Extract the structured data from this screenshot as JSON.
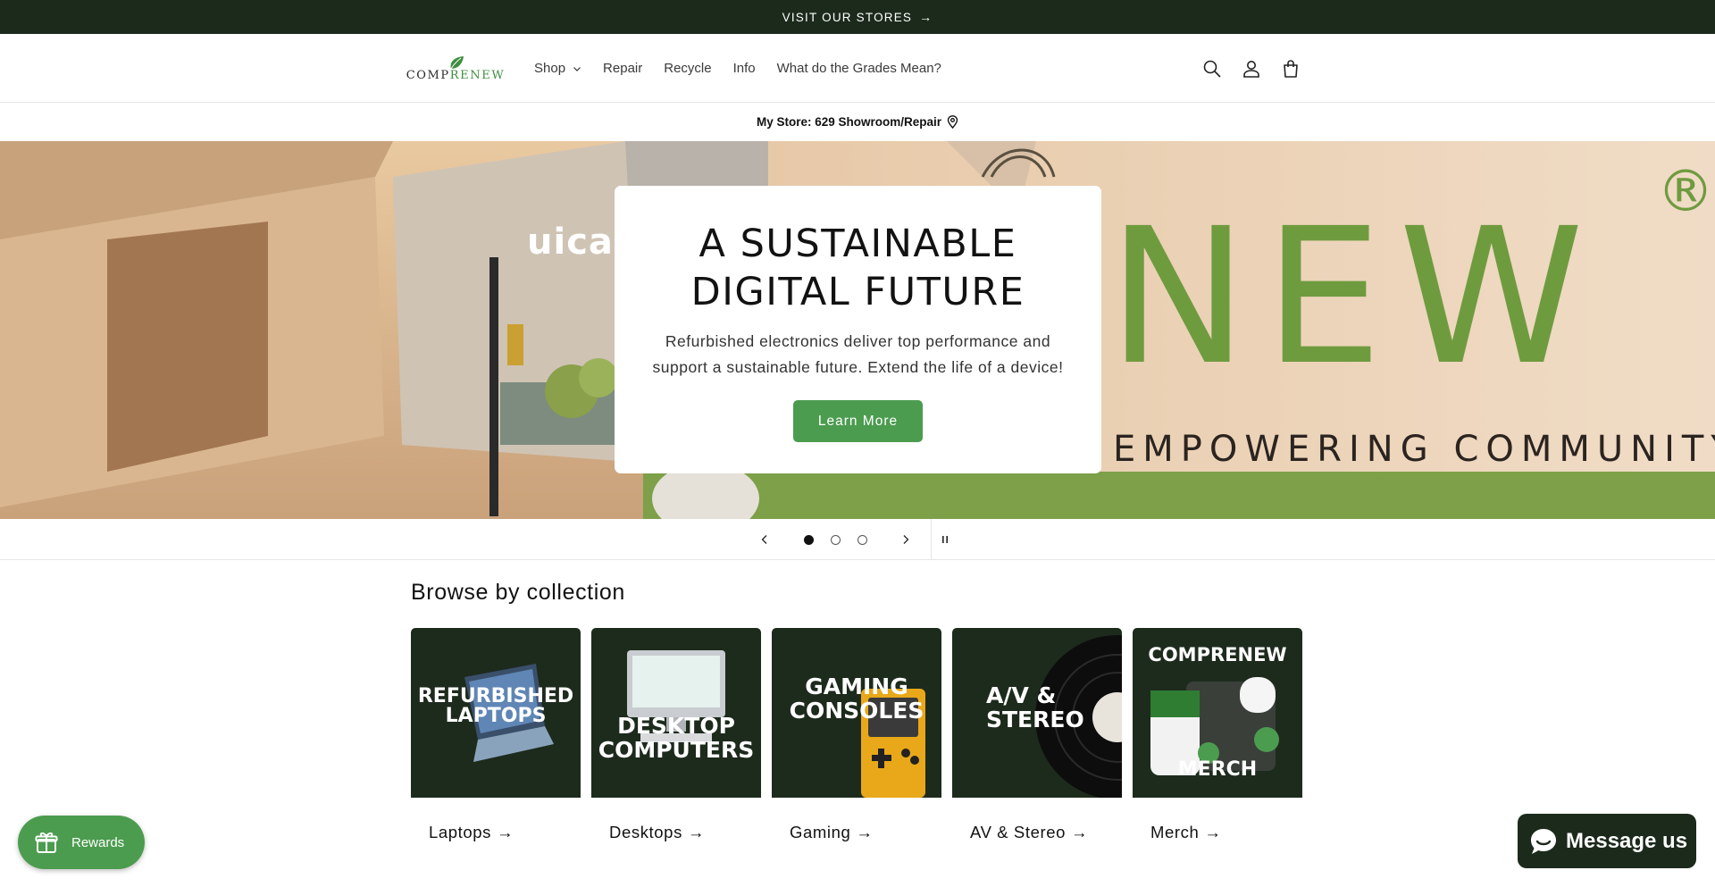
{
  "announcement": {
    "text": "VISIT OUR STORES",
    "arrow": "→"
  },
  "logo": {
    "part1": "COMP",
    "part2": "RENEW",
    "leaf_color": "#3e8e3e"
  },
  "nav": {
    "items": [
      {
        "label": "Shop",
        "has_dropdown": true
      },
      {
        "label": "Repair"
      },
      {
        "label": "Recycle"
      },
      {
        "label": "Info"
      },
      {
        "label": "What do the Grades Mean?"
      }
    ]
  },
  "header_icons": [
    "search-icon",
    "account-icon",
    "cart-icon"
  ],
  "store": {
    "label": "My Store: 629 Showroom/Repair",
    "icon": "map-pin-icon"
  },
  "hero": {
    "title": "A SUSTAINABLE DIGITAL FUTURE",
    "subtitle": "Refurbished electronics deliver top performance and support a sustainable future. Extend the life of a device!",
    "button": "Learn More",
    "bg_text_big": "NEW",
    "bg_text_small": "EMPOWERING COMMUNITY",
    "bg_text_building": "uica",
    "bg_registered": "®"
  },
  "slider": {
    "slide_count": 3,
    "active_slide": 1
  },
  "collections": {
    "title": "Browse by collection",
    "cards": [
      {
        "label": "Laptops",
        "image_text_1": "REFURBISHED",
        "image_text_2": "LAPTOPS"
      },
      {
        "label": "Desktops",
        "image_text_1": "DESKTOP",
        "image_text_2": "COMPUTERS"
      },
      {
        "label": "Gaming",
        "image_text_1": "GAMING",
        "image_text_2": "CONSOLES"
      },
      {
        "label": "AV & Stereo",
        "image_text_1": "A/V &",
        "image_text_2": "STEREO"
      },
      {
        "label": "Merch",
        "image_text_1": "COMPRENEW",
        "image_text_2": "MERCH"
      }
    ],
    "arrow": "→"
  },
  "rewards": {
    "label": "Rewards"
  },
  "message": {
    "label": "Message us"
  },
  "colors": {
    "dark_green": "#1c2a1c",
    "brand_green": "#4c9c4f"
  }
}
